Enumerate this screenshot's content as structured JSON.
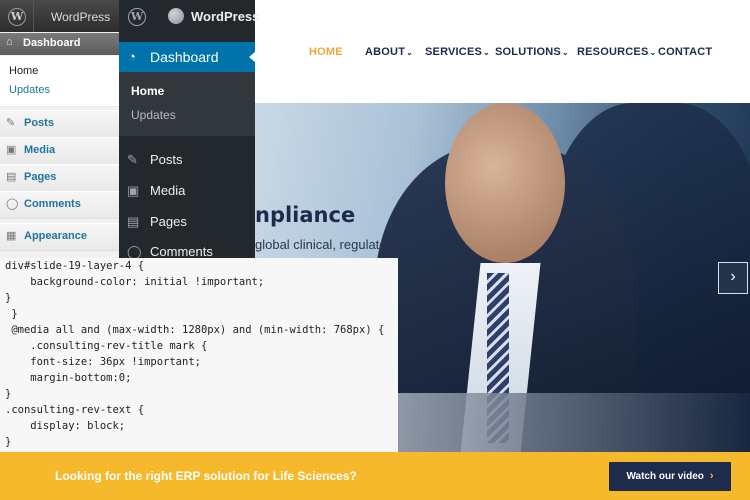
{
  "website": {
    "nav": [
      {
        "label": "HOME",
        "active": true,
        "dropdown": false
      },
      {
        "label": "ABOUT",
        "active": false,
        "dropdown": true
      },
      {
        "label": "SERVICES",
        "active": false,
        "dropdown": true
      },
      {
        "label": "SOLUTIONS",
        "active": false,
        "dropdown": true
      },
      {
        "label": "RESOURCES",
        "active": false,
        "dropdown": true
      },
      {
        "label": "CONTACT",
        "active": false,
        "dropdown": false
      }
    ],
    "hero": {
      "title_fragment": "npliance",
      "subtitle_fragment": "global clinical, regulatory,"
    },
    "next_arrow": "›",
    "cta": {
      "text": "Looking for the right ERP solution for Life Sciences?",
      "button_label": "Watch our video",
      "button_arrow": "›"
    },
    "colors": {
      "accent": "#f2a73b",
      "cta_bar": "#f7b92c",
      "navy": "#1d2b4c"
    }
  },
  "old_admin": {
    "site_name": "WordPress",
    "dashboard": "Dashboard",
    "submenu": [
      "Home",
      "Updates"
    ],
    "items": [
      {
        "label": "Posts",
        "icon": "pin-icon"
      },
      {
        "label": "Media",
        "icon": "media-icon"
      },
      {
        "label": "Pages",
        "icon": "pages-icon"
      },
      {
        "label": "Comments",
        "icon": "comments-icon"
      },
      {
        "label": "Appearance",
        "icon": "appearance-icon"
      }
    ]
  },
  "new_admin": {
    "site_name": "WordPress",
    "dashboard": "Dashboard",
    "submenu": [
      "Home",
      "Updates"
    ],
    "items": [
      {
        "label": "Posts",
        "icon": "pin-icon"
      },
      {
        "label": "Media",
        "icon": "media-icon"
      },
      {
        "label": "Pages",
        "icon": "pages-icon"
      },
      {
        "label": "Comments",
        "icon": "comments-icon"
      }
    ],
    "colors": {
      "menu_bg": "#23282d",
      "active": "#0073aa"
    }
  },
  "code": [
    "div#slide-19-layer-4 {",
    "    background-color: initial !important;",
    "}",
    " }",
    " @media all and (max-width: 1280px) and (min-width: 768px) {",
    "    .consulting-rev-title mark {",
    "    font-size: 36px !important;",
    "    margin-bottom:0;",
    "}",
    ".consulting-rev-text {",
    "    display: block;",
    "}"
  ]
}
